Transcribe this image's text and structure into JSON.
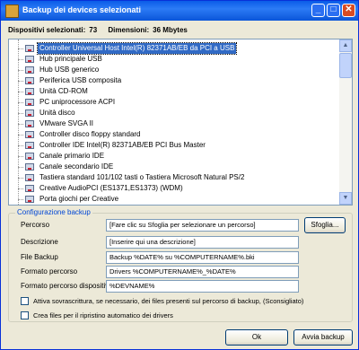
{
  "window": {
    "title": "Backup dei devices selezionati"
  },
  "summary": {
    "selected_label": "Dispositivi selezionati:",
    "selected_value": "73",
    "size_label": "Dimensioni:",
    "size_value": "36 Mbytes"
  },
  "devices": [
    "Controller Universal Host Intel(R) 82371AB/EB da PCI a USB",
    "Hub principale USB",
    "Hub USB generico",
    "Periferica USB composita",
    "Unità CD-ROM",
    "PC uniprocessore ACPI",
    "Unità disco",
    "VMware SVGA II",
    "Controller disco floppy standard",
    "Controller IDE Intel(R) 82371AB/EB PCI Bus Master",
    "Canale primario IDE",
    "Canale secondario IDE",
    "Tastiera standard 101/102 tasti o Tastiera Microsoft Natural PS/2",
    "Creative AudioPCI (ES1371,ES1373) (WDM)",
    "Porta giochi per Creative"
  ],
  "config": {
    "title": "Configurazione backup",
    "percorso_label": "Percorso",
    "percorso_value": "[Fare clic su Sfoglia per selezionare un percorso]",
    "browse_label": "Sfoglia...",
    "descrizione_label": "Descrizione",
    "descrizione_value": "[Inserire qui una descrizione]",
    "file_label": "File Backup",
    "file_value": "Backup %DATE% su %COMPUTERNAME%.bki",
    "formato_label": "Formato percorso",
    "formato_value": "Drivers %COMPUTERNAME%_%DATE%",
    "formato_disp_label": "Formato percorso dispositivo",
    "formato_disp_value": "%DEVNAME%",
    "overwrite_label": "Attiva sovrascrittura, se necessario, dei files presenti sul percorso di backup, (Sconsigliato)",
    "restore_label": "Crea files per il ripristino automatico dei drivers"
  },
  "buttons": {
    "ok": "Ok",
    "start": "Avvia backup"
  }
}
